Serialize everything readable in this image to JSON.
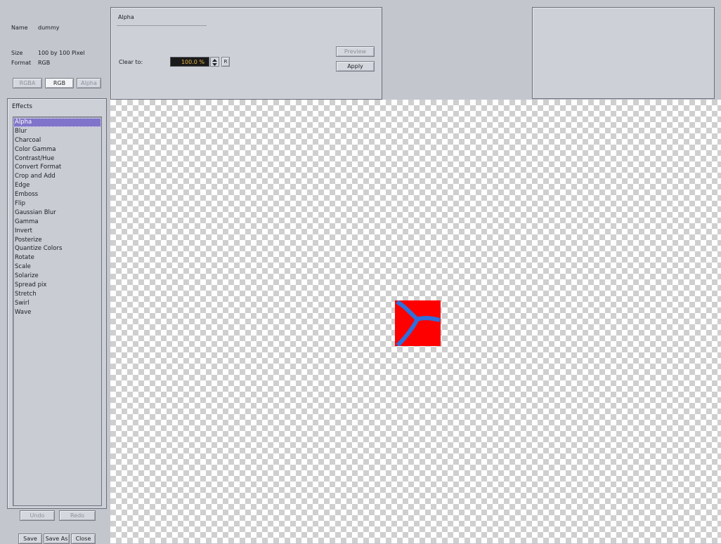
{
  "info": {
    "name_label": "Name",
    "name_value": "dummy",
    "size_label": "Size",
    "size_value": "100 by 100 Pixel",
    "format_label": "Format",
    "format_value": "RGB"
  },
  "channel_tabs": {
    "rgba": "RGBA",
    "rgb": "RGB",
    "alpha": "Alpha",
    "selected": "RGB"
  },
  "effect_panel": {
    "title": "Alpha",
    "clear_to_label": "Clear to:",
    "clear_to_value": "100.0 %",
    "reset_label": "R",
    "preview_label": "Preview",
    "apply_label": "Apply"
  },
  "effects": {
    "title": "Effects",
    "items": [
      "Alpha",
      "Blur",
      "Charcoal",
      "Color Gamma",
      "Contrast/Hue",
      "Convert Format",
      "Crop and Add",
      "Edge",
      "Emboss",
      "Flip",
      "Gaussian Blur",
      "Gamma",
      "Invert",
      "Posterize",
      "Quantize Colors",
      "Rotate",
      "Scale",
      "Solarize",
      "Spread pix",
      "Stretch",
      "Swirl",
      "Wave"
    ],
    "selected_index": 0
  },
  "history": {
    "undo_label": "Undo",
    "redo_label": "Redo"
  },
  "file_actions": {
    "save_label": "Save",
    "save_as_label": "Save As",
    "close_label": "Close"
  },
  "colors": {
    "selection": "#7f74c9",
    "image_fill": "#ff0000",
    "image_stroke": "#2e6fdc",
    "spin_field_bg": "#1a1a1a",
    "spin_field_text": "#e8b44a"
  }
}
